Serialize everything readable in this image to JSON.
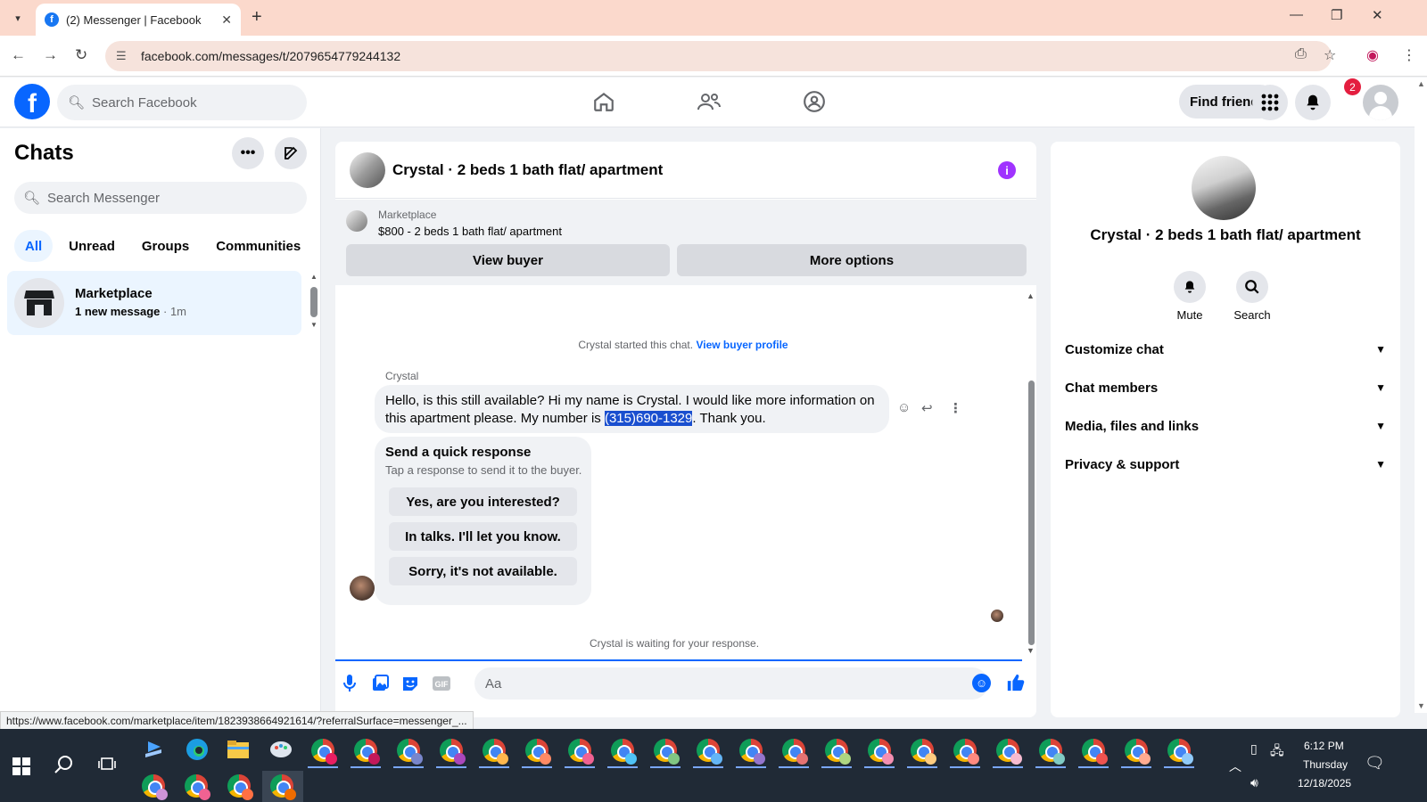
{
  "browser": {
    "tab_title": "(2) Messenger | Facebook",
    "url": "facebook.com/messages/t/2079654779244132",
    "status_url": "https://www.facebook.com/marketplace/item/1823938664921614/?referralSurface=messenger_..."
  },
  "header": {
    "search_placeholder": "Search Facebook",
    "find_friends": "Find friends",
    "notification_count": "2"
  },
  "sidebar": {
    "title": "Chats",
    "search_placeholder": "Search Messenger",
    "filters": [
      "All",
      "Unread",
      "Groups",
      "Communities"
    ],
    "chats": [
      {
        "name": "Marketplace",
        "preview": "1 new message",
        "time": " · 1m"
      }
    ]
  },
  "chat": {
    "title": "Crystal · 2 beds 1 bath flat/ apartment",
    "listing_label": "Marketplace",
    "listing_price": "$800 - 2 beds 1 bath flat/ apartment",
    "view_buyer": "View buyer",
    "more_options": "More options",
    "started_text": "Crystal started this chat.",
    "view_buyer_profile": "View buyer profile",
    "sender": "Crystal",
    "message_before": "Hello, is this still available? Hi my name is Crystal. I would like more information on this apartment please. My number is ",
    "message_phone": "(315)690-1329",
    "message_after": ". Thank you.",
    "quick_title": "Send a quick response",
    "quick_subtitle": "Tap a response to send it to the buyer.",
    "quick_responses": [
      "Yes, are you interested?",
      "In talks. I'll let you know.",
      "Sorry, it's not available."
    ],
    "waiting_text": "Crystal is waiting for your response.",
    "composer_placeholder": "Aa"
  },
  "details": {
    "title": "Crystal · 2 beds 1 bath flat/ apartment",
    "actions": [
      "Mute",
      "Search"
    ],
    "sections": [
      "Customize chat",
      "Chat members",
      "Media, files and links",
      "Privacy & support"
    ]
  },
  "taskbar": {
    "time": "6:12 PM",
    "day": "Thursday",
    "date": "12/18/2025"
  },
  "colors": {
    "facebook_blue": "#0866ff",
    "tab_strip": "#fbd9cc",
    "info_purple": "#a033ff",
    "badge_red": "#e41e3f",
    "taskbar": "#202a36"
  }
}
